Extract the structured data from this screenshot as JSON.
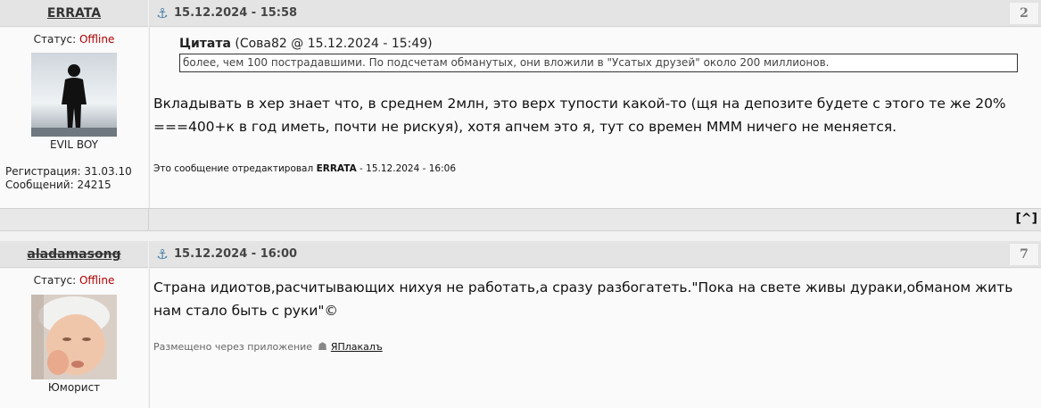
{
  "posts": [
    {
      "author": "ERRATA",
      "date": "15.12.2024 - 15:58",
      "number": "2",
      "status_label": "Статус:",
      "status_value": "Offline",
      "avatar_caption": "EVIL BOY",
      "reg": "Регистрация: 31.03.10",
      "msgs": "Сообщений: 24215",
      "quote": {
        "label": "Цитата",
        "meta": "(Сова82 @ 15.12.2024 - 15:49)",
        "text": "более, чем 100 пострадавшими. По подсчетам обманутых, они вложили в \"Усатых друзей\" около 200 миллионов."
      },
      "message": "Вкладывать в хер знает что, в среднем 2млн, это верх тупости какой-то (щя на депозите будете с этого те же 20% ===400+к в год иметь, почти не рискуя), хотя апчем это я, тут со времен МММ ничего не меняется.",
      "edited_prefix": "Это сообщение отредактировал",
      "edited_by": "ERRATA",
      "edited_suffix": "- 15.12.2024 - 16:06"
    },
    {
      "author": "aladamasong",
      "date": "15.12.2024 - 16:00",
      "number": "7",
      "status_label": "Статус:",
      "status_value": "Offline",
      "avatar_caption": "Юморист",
      "message": "Страна идиотов,расчитывающих нихуя не работать,а сразу разбогатеть.\"Пока на свете живы дураки,обманом жить нам стало быть с руки\"©",
      "via_text": "Размещено через приложение",
      "via_app": "ЯПлакалъ"
    }
  ],
  "top_link": "[^]",
  "icons": {
    "anchor": "anchor-icon",
    "android": "android-icon"
  },
  "colors": {
    "offline": "#b00000",
    "header_bg": "#e4e4e4",
    "anchor": "#4a7fa8"
  }
}
